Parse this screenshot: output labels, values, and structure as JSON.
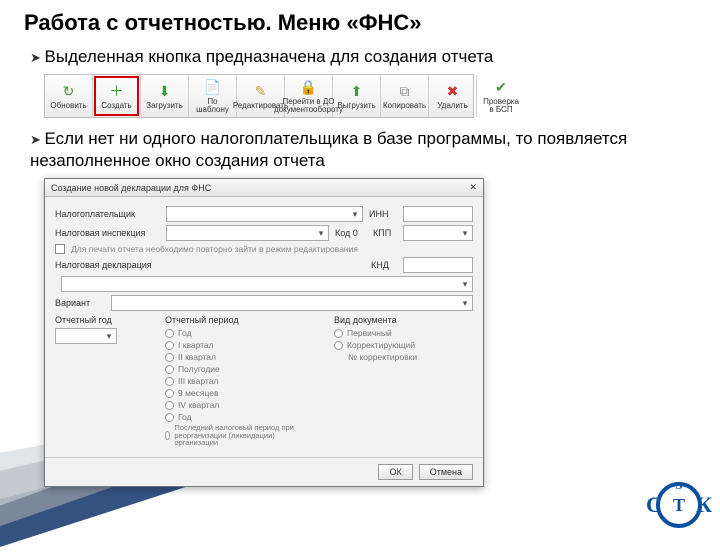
{
  "title": "Работа с отчетностью. Меню «ФНС»",
  "bullets": {
    "b1": "Выделенная кнопка  предназначена для создания отчета",
    "b2": "Если нет ни одного налогоплательщика в базе программы, то появляется незаполненное окно создания отчета"
  },
  "toolbar": [
    {
      "name": "refresh",
      "label": "Обновить",
      "icon": "↻",
      "color": "#3a9a3a"
    },
    {
      "name": "create",
      "label": "Создать",
      "icon": "＋",
      "color": "#3a9a3a",
      "highlighted": true
    },
    {
      "name": "load",
      "label": "Загрузить",
      "icon": "⬇",
      "color": "#3a9a3a"
    },
    {
      "name": "fromtpl",
      "label": "По шаблону",
      "icon": "📄",
      "color": "#888"
    },
    {
      "name": "edit",
      "label": "Редактировать",
      "icon": "✎",
      "color": "#caa23a"
    },
    {
      "name": "tosend",
      "label": "Перейти в ДО\nдокументообороту",
      "icon": "🔒",
      "color": "#888"
    },
    {
      "name": "upload",
      "label": "Выгрузить",
      "icon": "⬆",
      "color": "#3a9a3a"
    },
    {
      "name": "copy",
      "label": "Копировать",
      "icon": "⧉",
      "color": "#888"
    },
    {
      "name": "delete",
      "label": "Удалить",
      "icon": "✖",
      "color": "#c33"
    },
    {
      "name": "checkbsp",
      "label": "Проверка\nв БСП",
      "icon": "✔",
      "color": "#3a9a3a"
    }
  ],
  "dialog": {
    "title": "Создание новой декларации для ФНС",
    "close": "✕",
    "labels": {
      "payer": "Налогоплательщик",
      "inn": "ИНН",
      "inspection": "Налоговая инспекция",
      "code": "Код 0",
      "kpp": "КПП",
      "instruction": "Для печати отчета необходимо повторно зайти в режим редактирования",
      "declaration": "Налоговая декларация",
      "knd": "КНД",
      "variant": "Вариант",
      "year": "Отчетный год",
      "period": "Отчетный период",
      "doctype": "Вид документа"
    },
    "period_options": [
      "Год",
      "I квартал",
      "II квартал",
      "Полугодие",
      "III квартал",
      "9 месяцев",
      "IV квартал",
      "Год",
      "Последний налоговый период при реорганизации (ликвидации) организации"
    ],
    "doctype_options": [
      "Первичный",
      "Корректирующий",
      "№ корректировки"
    ],
    "footer": {
      "ok": "ОК",
      "cancel": "Отмена"
    }
  },
  "logo": {
    "text": "СТЭК"
  }
}
